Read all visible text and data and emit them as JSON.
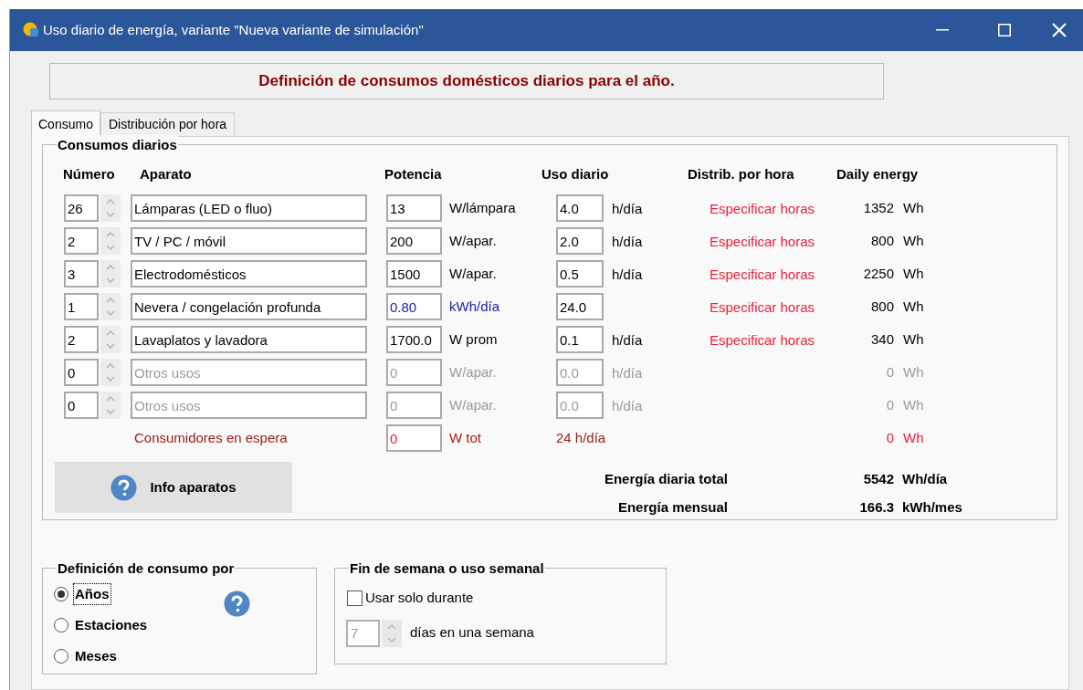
{
  "window": {
    "title": "Uso diario de energía, variante \"Nueva variante de simulación\""
  },
  "header": "Definición de consumos domésticos diarios para el año.",
  "tabs": [
    {
      "label": "Consumo",
      "selected": true
    },
    {
      "label": "Distribución por hora",
      "selected": false
    }
  ],
  "daily": {
    "title": "Consumos diarios",
    "columns": [
      "Número",
      "Aparato",
      "Potencia",
      "Uso diario",
      "Distrib. por hora",
      "Daily energy"
    ],
    "rows": [
      {
        "kind": "power",
        "disabled": false,
        "number": "26",
        "appliance": "Lámparas (LED o fluo)",
        "power": "13",
        "power_unit": "W/lámpara",
        "usage": "4.0",
        "usage_unit": "h/día",
        "distribution": "Especificar horas",
        "energy": "1352",
        "energy_unit": "Wh"
      },
      {
        "kind": "power",
        "disabled": false,
        "number": "2",
        "appliance": "TV / PC / móvil",
        "power": "200",
        "power_unit": "W/apar.",
        "usage": "2.0",
        "usage_unit": "h/día",
        "distribution": "Especificar horas",
        "energy": "800",
        "energy_unit": "Wh"
      },
      {
        "kind": "power",
        "disabled": false,
        "number": "3",
        "appliance": "Electrodomésticos",
        "power": "1500",
        "power_unit": "W/apar.",
        "usage": "0.5",
        "usage_unit": "h/día",
        "distribution": "Especificar horas",
        "energy": "2250",
        "energy_unit": "Wh"
      },
      {
        "kind": "energy",
        "disabled": false,
        "number": "1",
        "appliance": "Nevera / congelación profunda",
        "power": "0.80",
        "power_unit": "kWh/día",
        "usage": "24.0",
        "distribution": "Especificar horas",
        "energy": "800",
        "energy_unit": "Wh"
      },
      {
        "kind": "power",
        "disabled": false,
        "number": "2",
        "appliance": "Lavaplatos y lavadora",
        "power": "1700.0",
        "power_unit": "W prom",
        "usage": "0.1",
        "usage_unit": "h/día",
        "distribution": "Especificar horas",
        "energy": "340",
        "energy_unit": "Wh"
      },
      {
        "kind": "power",
        "disabled": true,
        "number": "0",
        "appliance": "Otros usos",
        "power": "0",
        "power_unit": "W/apar.",
        "usage": "0.0",
        "usage_unit": "h/día",
        "energy": "0",
        "energy_unit": "Wh"
      },
      {
        "kind": "power",
        "disabled": true,
        "number": "0",
        "appliance": "Otros usos",
        "power": "0",
        "power_unit": "W/apar.",
        "usage": "0.0",
        "usage_unit": "h/día",
        "energy": "0",
        "energy_unit": "Wh"
      }
    ],
    "standby": {
      "label": "Consumidores en espera",
      "power": "0",
      "power_unit": "W tot",
      "usage": "24 h/día",
      "energy": "0",
      "energy_unit": "Wh"
    },
    "info_button": "Info aparatos",
    "totals": [
      {
        "label": "Energía diaria total",
        "value": "5542",
        "unit": "Wh/día"
      },
      {
        "label": "Energía mensual",
        "value": "166.3",
        "unit": "kWh/mes"
      }
    ]
  },
  "definition": {
    "title": "Definición de consumo por",
    "options": [
      {
        "label": "Años",
        "selected": true
      },
      {
        "label": "Estaciones",
        "selected": false
      },
      {
        "label": "Meses",
        "selected": false
      }
    ]
  },
  "weekly": {
    "title": "Fin de semana o uso semanal",
    "checkbox": {
      "label": "Usar solo durante",
      "checked": false
    },
    "days": {
      "value": "7",
      "disabled": true,
      "label": "días en una semana"
    }
  }
}
